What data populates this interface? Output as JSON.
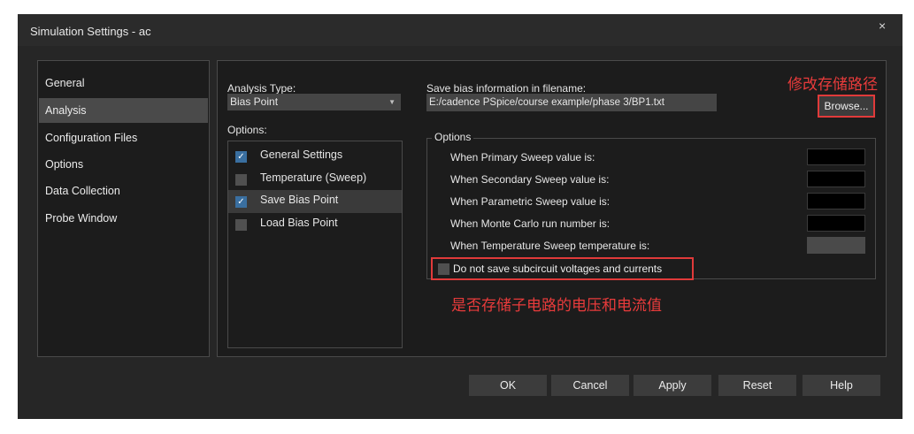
{
  "window": {
    "title": "Simulation Settings - ac",
    "close_glyph": "×"
  },
  "nav": {
    "items": [
      {
        "label": "General"
      },
      {
        "label": "Analysis",
        "selected": true
      },
      {
        "label": "Configuration Files"
      },
      {
        "label": "Options"
      },
      {
        "label": "Data Collection"
      },
      {
        "label": "Probe Window"
      }
    ]
  },
  "analysis": {
    "type_label": "Analysis Type:",
    "type_value": "Bias Point",
    "options_label": "Options:",
    "options": [
      {
        "label": "General Settings",
        "checked": true
      },
      {
        "label": "Temperature (Sweep)",
        "checked": false
      },
      {
        "label": "Save Bias Point",
        "checked": true,
        "highlighted": true
      },
      {
        "label": "Load Bias Point",
        "checked": false
      }
    ]
  },
  "save_bias": {
    "label": "Save bias information in filename:",
    "path": "E:/cadence PSpice/course example/phase 3/BP1.txt",
    "browse_label": "Browse...",
    "group_title": "Options",
    "rows": [
      {
        "label": "When Primary Sweep value is:"
      },
      {
        "label": "When Secondary Sweep value is:"
      },
      {
        "label": "When Parametric Sweep value is:"
      },
      {
        "label": "When Monte Carlo run number is:"
      },
      {
        "label": "When Temperature Sweep temperature is:"
      }
    ],
    "subcircuit_label": "Do not save subcircuit voltages and currents",
    "subcircuit_checked": false
  },
  "annotations": {
    "path_note": "修改存储路径",
    "subcircuit_note": "是否存储子电路的电压和电流值"
  },
  "buttons": {
    "ok": "OK",
    "cancel": "Cancel",
    "apply": "Apply",
    "reset": "Reset",
    "help": "Help"
  },
  "colors": {
    "annotation": "#e83b3b",
    "highlight_box": "#e03a3a",
    "check_accent": "#3a6fa0"
  }
}
